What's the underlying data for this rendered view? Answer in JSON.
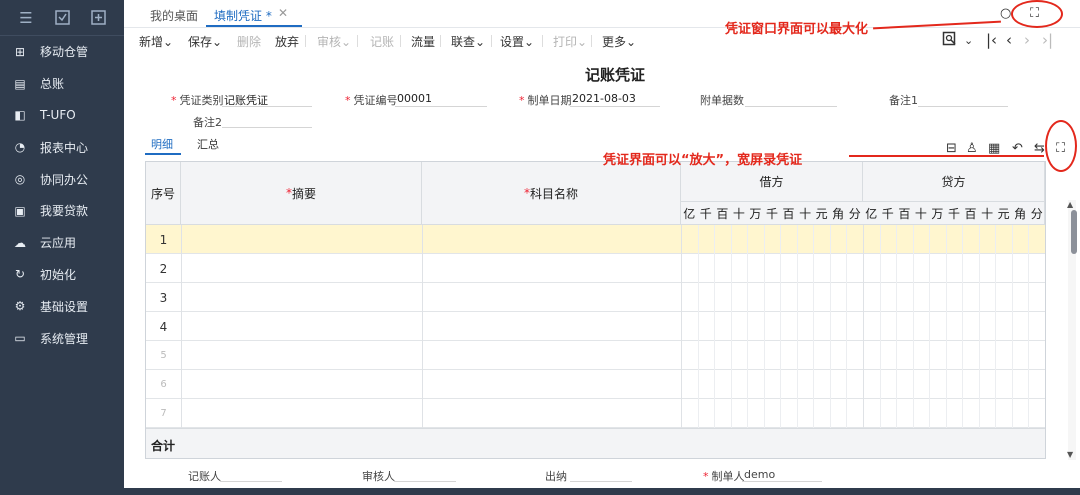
{
  "sidebar": {
    "top_icons": [
      "menu-icon",
      "monitor-icon",
      "add-page-icon"
    ],
    "items": [
      {
        "label": "移动仓管",
        "icon": "warehouse-icon"
      },
      {
        "label": "总账",
        "icon": "ledger-icon"
      },
      {
        "label": "T-UFO",
        "icon": "ufo-icon"
      },
      {
        "label": "报表中心",
        "icon": "pie-chart-icon"
      },
      {
        "label": "协同办公",
        "icon": "collaboration-icon"
      },
      {
        "label": "我要贷款",
        "icon": "loan-icon"
      },
      {
        "label": "云应用",
        "icon": "cloud-icon"
      },
      {
        "label": "初始化",
        "icon": "refresh-icon"
      },
      {
        "label": "基础设置",
        "icon": "settings-icon"
      },
      {
        "label": "系统管理",
        "icon": "system-icon"
      }
    ]
  },
  "tabs": [
    {
      "label": "我的桌面",
      "active": false
    },
    {
      "label": "填制凭证 *",
      "active": true
    }
  ],
  "toolbar": {
    "new": "新增",
    "save": "保存",
    "delete": "删除",
    "discard": "放弃",
    "audit": "审核",
    "post": "记账",
    "flow": "流量",
    "link": "联查",
    "settings": "设置",
    "print": "打印",
    "more": "更多"
  },
  "voucher": {
    "title": "记账凭证",
    "type_label": "凭证类别",
    "type_value": "记账凭证",
    "number_label": "凭证编号",
    "number_value": "00001",
    "date_label": "制单日期",
    "date_value": "2021-08-03",
    "attachments_label": "附单据数",
    "note1_label": "备注1",
    "note2_label": "备注2"
  },
  "subtabs": [
    "明细",
    "汇总"
  ],
  "grid": {
    "seq_header": "序号",
    "summary_header": "摘要",
    "account_header": "科目名称",
    "debit_header": "借方",
    "credit_header": "贷方",
    "digits": [
      "亿",
      "千",
      "百",
      "十",
      "万",
      "千",
      "百",
      "十",
      "元",
      "角",
      "分"
    ],
    "rows": [
      "1",
      "2",
      "3",
      "4",
      "5",
      "6",
      "7"
    ],
    "total_label": "合计"
  },
  "footer": {
    "bookkeeper": "记账人",
    "auditor": "审核人",
    "cashier": "出纳",
    "maker_label": "制单人",
    "maker_value": "demo"
  },
  "annotations": {
    "maximize_window": "凭证窗口界面可以最大化",
    "enlarge_view": "凭证界面可以“放大”，宽屏录凭证"
  },
  "colors": {
    "sidebar_bg": "#2f3b4c",
    "accent": "#1f6cc2",
    "annotation": "#e3281c",
    "selected_row": "#fff6cf"
  }
}
